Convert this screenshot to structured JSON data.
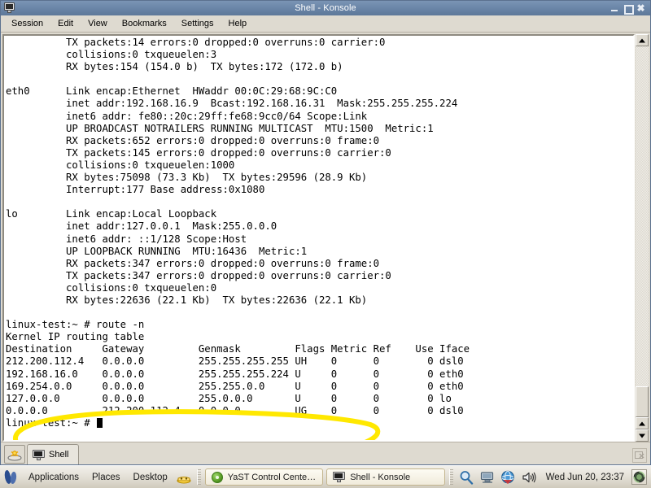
{
  "window": {
    "title": "Shell - Konsole",
    "icon": "konsole-icon",
    "buttons": {
      "minimize": "minimize",
      "maximize": "maximize",
      "close": "close"
    }
  },
  "menubar": {
    "items": [
      {
        "label": "Session"
      },
      {
        "label": "Edit"
      },
      {
        "label": "View"
      },
      {
        "label": "Bookmarks"
      },
      {
        "label": "Settings"
      },
      {
        "label": "Help"
      }
    ]
  },
  "terminal": {
    "content": "          TX packets:14 errors:0 dropped:0 overruns:0 carrier:0\n          collisions:0 txqueuelen:3\n          RX bytes:154 (154.0 b)  TX bytes:172 (172.0 b)\n\neth0      Link encap:Ethernet  HWaddr 00:0C:29:68:9C:C0\n          inet addr:192.168.16.9  Bcast:192.168.16.31  Mask:255.255.255.224\n          inet6 addr: fe80::20c:29ff:fe68:9cc0/64 Scope:Link\n          UP BROADCAST NOTRAILERS RUNNING MULTICAST  MTU:1500  Metric:1\n          RX packets:652 errors:0 dropped:0 overruns:0 frame:0\n          TX packets:145 errors:0 dropped:0 overruns:0 carrier:0\n          collisions:0 txqueuelen:1000\n          RX bytes:75098 (73.3 Kb)  TX bytes:29596 (28.9 Kb)\n          Interrupt:177 Base address:0x1080\n\nlo        Link encap:Local Loopback\n          inet addr:127.0.0.1  Mask:255.0.0.0\n          inet6 addr: ::1/128 Scope:Host\n          UP LOOPBACK RUNNING  MTU:16436  Metric:1\n          RX packets:347 errors:0 dropped:0 overruns:0 frame:0\n          TX packets:347 errors:0 dropped:0 overruns:0 carrier:0\n          collisions:0 txqueuelen:0\n          RX bytes:22636 (22.1 Kb)  TX bytes:22636 (22.1 Kb)\n\nlinux-test:~ # route -n\nKernel IP routing table\nDestination     Gateway         Genmask         Flags Metric Ref    Use Iface\n212.200.112.4   0.0.0.0         255.255.255.255 UH    0      0        0 dsl0\n192.168.16.0    0.0.0.0         255.255.255.224 U     0      0        0 eth0\n169.254.0.0     0.0.0.0         255.255.0.0     U     0      0        0 eth0\n127.0.0.0       0.0.0.0         255.0.0.0       U     0      0        0 lo\n0.0.0.0         212.200.112.4   0.0.0.0         UG    0      0        0 dsl0\n",
    "prompt": "linux-test:~ # ",
    "annotation": {
      "shape": "ellipse",
      "color": "#ffe800",
      "target": "default-route-row"
    }
  },
  "scrollbar": {
    "up_arrow": "scroll-up-arrow",
    "down_arrow": "scroll-down-arrow"
  },
  "tabbar": {
    "new_tab_label": "",
    "tabs": [
      {
        "label": "Shell",
        "icon": "konsole-icon",
        "active": true
      }
    ]
  },
  "panel": {
    "menus": [
      {
        "label": "Applications"
      },
      {
        "label": "Places"
      },
      {
        "label": "Desktop"
      }
    ],
    "tasks": [
      {
        "label": "YaST Control Center @ linu...",
        "icon": "yast-icon"
      },
      {
        "label": "Shell - Konsole",
        "icon": "konsole-icon"
      }
    ],
    "tray": [
      {
        "icon": "search-icon"
      },
      {
        "icon": "display-icon"
      },
      {
        "icon": "network-globe-icon"
      },
      {
        "icon": "volume-icon"
      }
    ],
    "clock": "Wed Jun 20, 23:37"
  }
}
